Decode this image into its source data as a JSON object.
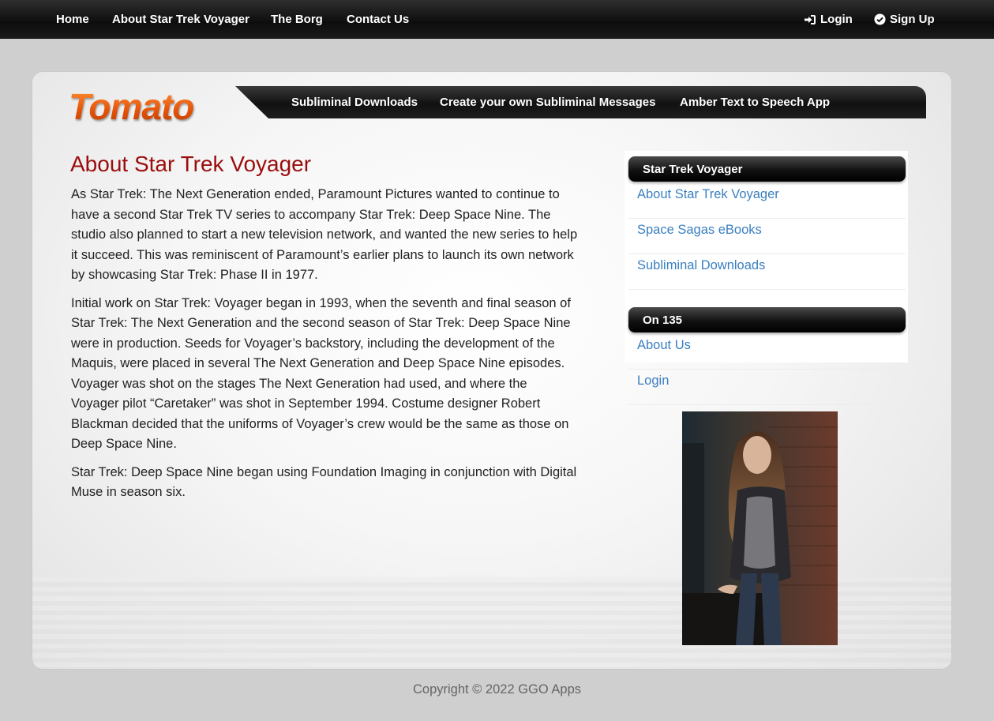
{
  "topnav": {
    "links": [
      "Home",
      "About Star Trek Voyager",
      "The Borg",
      "Contact Us"
    ],
    "login": "Login",
    "signup": "Sign Up"
  },
  "logo": "Tomato",
  "subnav": {
    "links": [
      "Subliminal Downloads",
      "Create your own Subliminal Messages",
      "Amber Text to Speech App"
    ]
  },
  "article": {
    "title": "About Star Trek Voyager",
    "paragraphs": [
      "As Star Trek: The Next Generation ended, Paramount Pictures wanted to continue to have a second Star Trek TV series to accompany Star Trek: Deep Space Nine. The studio also planned to start a new television network, and wanted the new series to help it succeed. This was reminiscent of Paramount’s earlier plans to launch its own network by showcasing Star Trek: Phase II in 1977.",
      "Initial work on Star Trek: Voyager began in 1993, when the seventh and final season of Star Trek: The Next Generation and the second season of Star Trek: Deep Space Nine were in production. Seeds for Voyager’s backstory, including the development of the Maquis, were placed in several The Next Generation and Deep Space Nine episodes. Voyager was shot on the stages The Next Generation had used, and where the Voyager pilot “Caretaker” was shot in September 1994. Costume designer Robert Blackman decided that the uniforms of Voyager’s crew would be the same as those on Deep Space Nine.",
      "Star Trek: Deep Space Nine began using Foundation Imaging in conjunction with Digital Muse in season six."
    ]
  },
  "sidebar": {
    "widgets": [
      {
        "title": "Star Trek Voyager",
        "items": [
          "About Star Trek Voyager",
          "Space Sagas eBooks",
          "Subliminal Downloads"
        ]
      },
      {
        "title": "On 135",
        "items": [
          "About Us",
          "Login"
        ]
      }
    ]
  },
  "footer": "Copyright © 2022 GGO Apps",
  "colors": {
    "title_red": "#9b0d0d",
    "link_blue": "#3a7fbf",
    "logo_orange": "#e0560d",
    "nav_black": "#111111"
  },
  "icons": {
    "login": "sign-in-icon",
    "signup": "check-circle-icon"
  }
}
